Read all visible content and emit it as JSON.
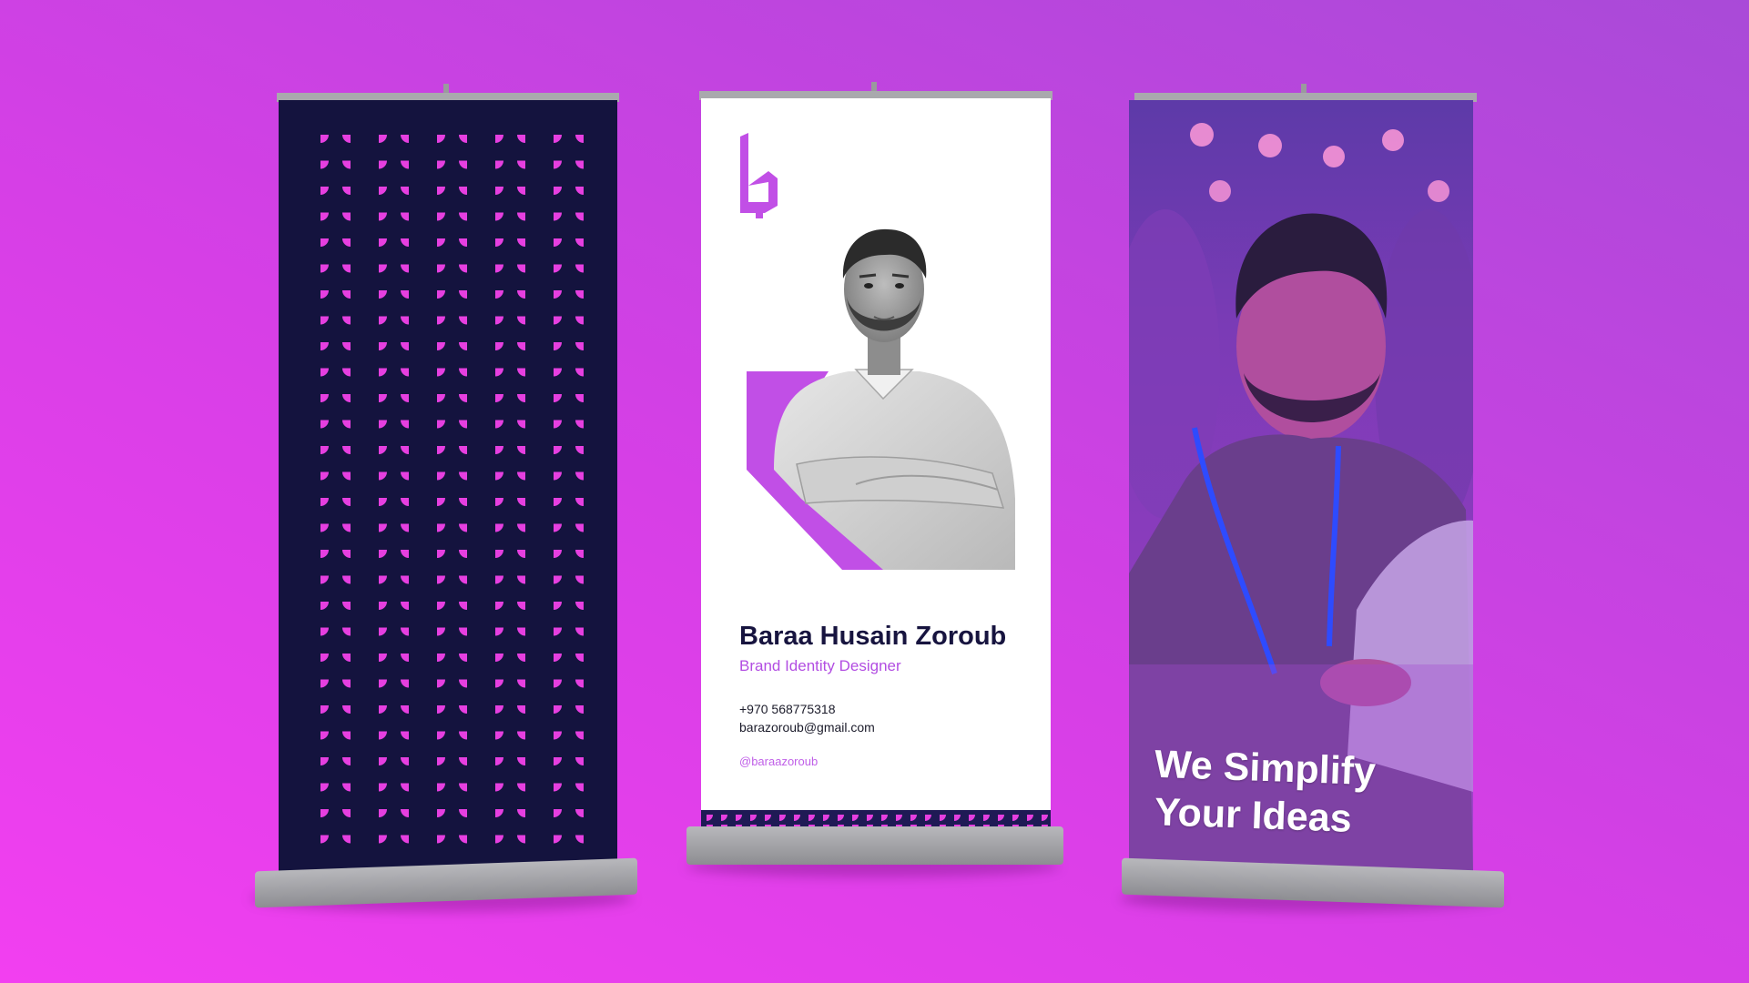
{
  "colors": {
    "navy": "#14133e",
    "accent_purple": "#b24de2",
    "pink": "#e63fe0",
    "steel": "#a9a9ad"
  },
  "middle_banner": {
    "logo_icon": "ba-monogram-icon",
    "name": "Baraa Husain Zoroub",
    "role": "Brand Identity Designer",
    "phone": "+970 568775318",
    "email": "barazoroub@gmail.com",
    "handle": "@baraazoroub"
  },
  "right_banner": {
    "tagline_line1": "We Simplify",
    "tagline_line2": "Your Ideas"
  }
}
